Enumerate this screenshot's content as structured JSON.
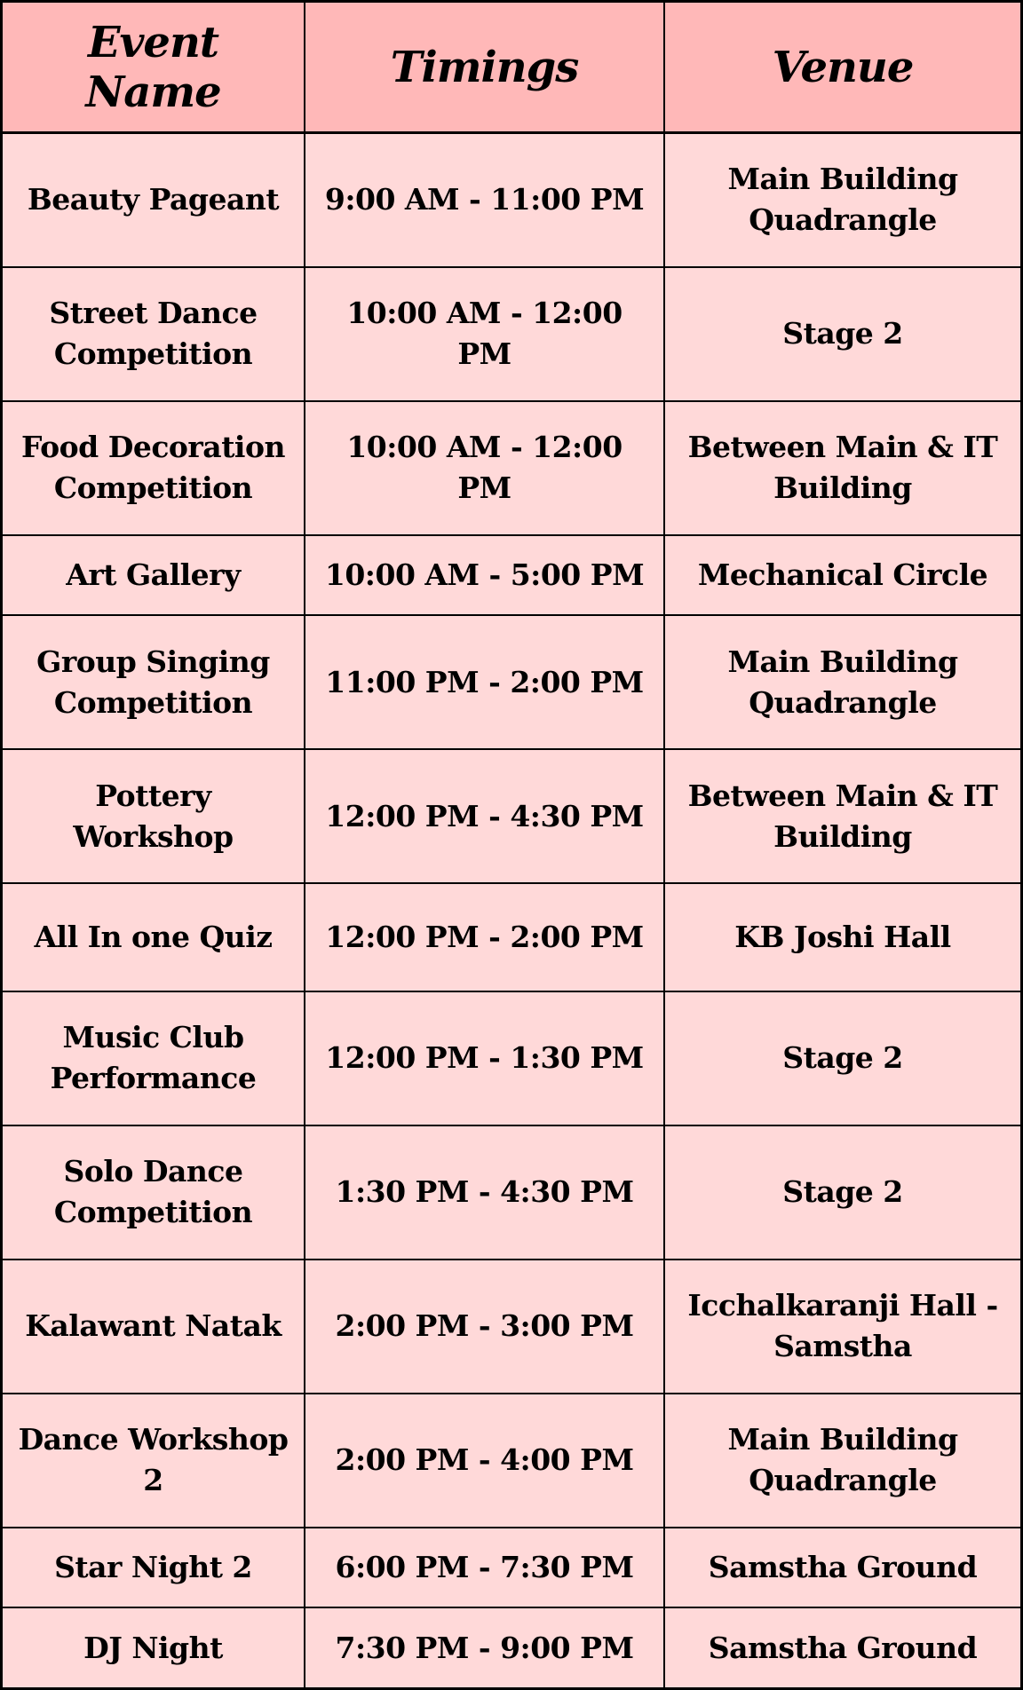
{
  "headers": {
    "event": "Event Name",
    "timings": "Timings",
    "venue": "Venue"
  },
  "rows": [
    {
      "event": "Beauty Pageant",
      "timings": "9:00 AM - 11:00 PM",
      "venue": "Main Building Quadrangle"
    },
    {
      "event": "Street Dance Competition",
      "timings": "10:00 AM - 12:00 PM",
      "venue": "Stage 2"
    },
    {
      "event": "Food Decoration Competition",
      "timings": "10:00 AM - 12:00 PM",
      "venue": "Between Main & IT Building"
    },
    {
      "event": "Art Gallery",
      "timings": "10:00 AM - 5:00 PM",
      "venue": "Mechanical Circle"
    },
    {
      "event": "Group Singing Competition",
      "timings": "11:00 PM - 2:00 PM",
      "venue": "Main Building Quadrangle"
    },
    {
      "event": "Pottery Workshop",
      "timings": "12:00 PM - 4:30 PM",
      "venue": "Between Main & IT Building"
    },
    {
      "event": "All In one Quiz",
      "timings": "12:00 PM - 2:00 PM",
      "venue": "KB Joshi Hall"
    },
    {
      "event": "Music Club Performance",
      "timings": "12:00 PM - 1:30 PM",
      "venue": "Stage 2"
    },
    {
      "event": "Solo Dance Competition",
      "timings": "1:30 PM - 4:30 PM",
      "venue": "Stage 2"
    },
    {
      "event": "Kalawant Natak",
      "timings": "2:00 PM - 3:00 PM",
      "venue": "Icchalkaranji Hall - Samstha"
    },
    {
      "event": "Dance Workshop 2",
      "timings": "2:00 PM - 4:00 PM",
      "venue": "Main Building Quadrangle"
    },
    {
      "event": "Star Night 2",
      "timings": "6:00 PM - 7:30 PM",
      "venue": "Samstha Ground"
    },
    {
      "event": "DJ Night",
      "timings": "7:30 PM - 9:00 PM",
      "venue": "Samstha Ground"
    }
  ]
}
